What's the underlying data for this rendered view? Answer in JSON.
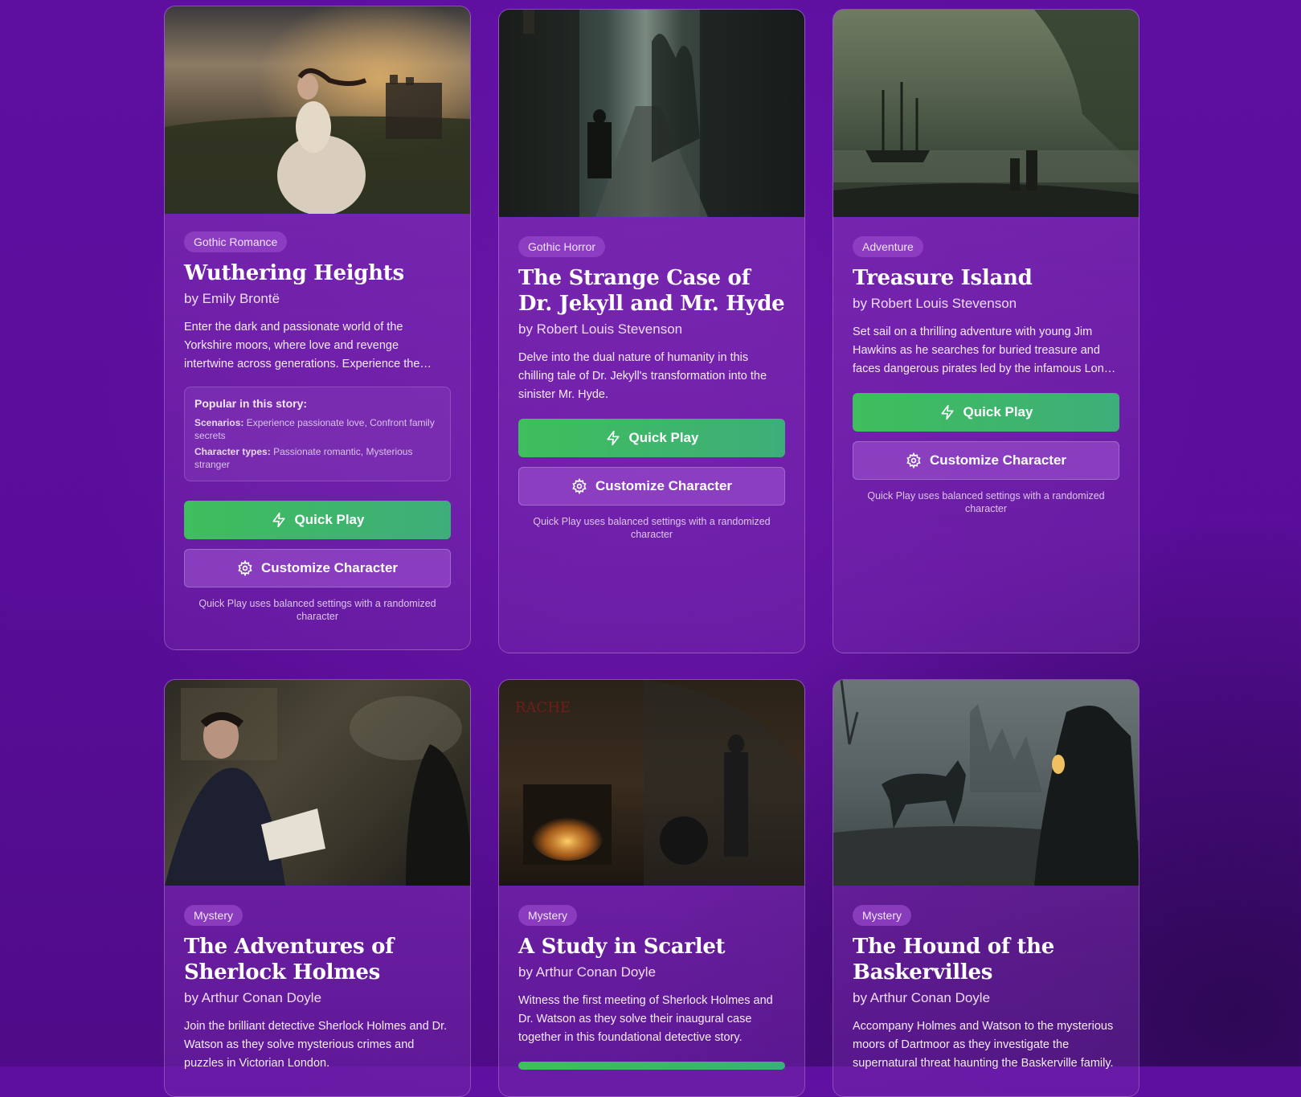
{
  "cards": [
    {
      "genre": "Gothic Romance",
      "title": "Wuthering Heights",
      "author": "by Emily Brontë",
      "description": "Enter the dark and passionate world of the Yorkshire moors, where love and revenge intertwine across generations. Experience the tempestuous relationship between Catherine and Heathcliff.",
      "popular": {
        "heading": "Popular in this story:",
        "scenarios_label": "Scenarios:",
        "scenarios": "Experience passionate love, Confront family secrets",
        "character_types_label": "Character types:",
        "character_types": "Passionate romantic, Mysterious stranger"
      },
      "quick_play_label": "Quick Play",
      "customize_label": "Customize Character",
      "note": "Quick Play uses balanced settings with a randomized character"
    },
    {
      "genre": "Gothic Horror",
      "title": "The Strange Case of Dr. Jekyll and Mr. Hyde",
      "author": "by Robert Louis Stevenson",
      "description": "Delve into the dual nature of humanity in this chilling tale of Dr. Jekyll's transformation into the sinister Mr. Hyde.",
      "quick_play_label": "Quick Play",
      "customize_label": "Customize Character",
      "note": "Quick Play uses balanced settings with a randomized character"
    },
    {
      "genre": "Adventure",
      "title": "Treasure Island",
      "author": "by Robert Louis Stevenson",
      "description": "Set sail on a thrilling adventure with young Jim Hawkins as he searches for buried treasure and faces dangerous pirates led by the infamous Long John Silver.",
      "quick_play_label": "Quick Play",
      "customize_label": "Customize Character",
      "note": "Quick Play uses balanced settings with a randomized character"
    },
    {
      "genre": "Mystery",
      "title": "The Adventures of Sherlock Holmes",
      "author": "by Arthur Conan Doyle",
      "description": "Join the brilliant detective Sherlock Holmes and Dr. Watson as they solve mysterious crimes and puzzles in Victorian London."
    },
    {
      "genre": "Mystery",
      "title": "A Study in Scarlet",
      "author": "by Arthur Conan Doyle",
      "description": "Witness the first meeting of Sherlock Holmes and Dr. Watson as they solve their inaugural case together in this foundational detective story."
    },
    {
      "genre": "Mystery",
      "title": "The Hound of the Baskervilles",
      "author": "by Arthur Conan Doyle",
      "description": "Accompany Holmes and Watson to the mysterious moors of Dartmoor as they investigate the supernatural threat haunting the Baskerville family."
    }
  ]
}
